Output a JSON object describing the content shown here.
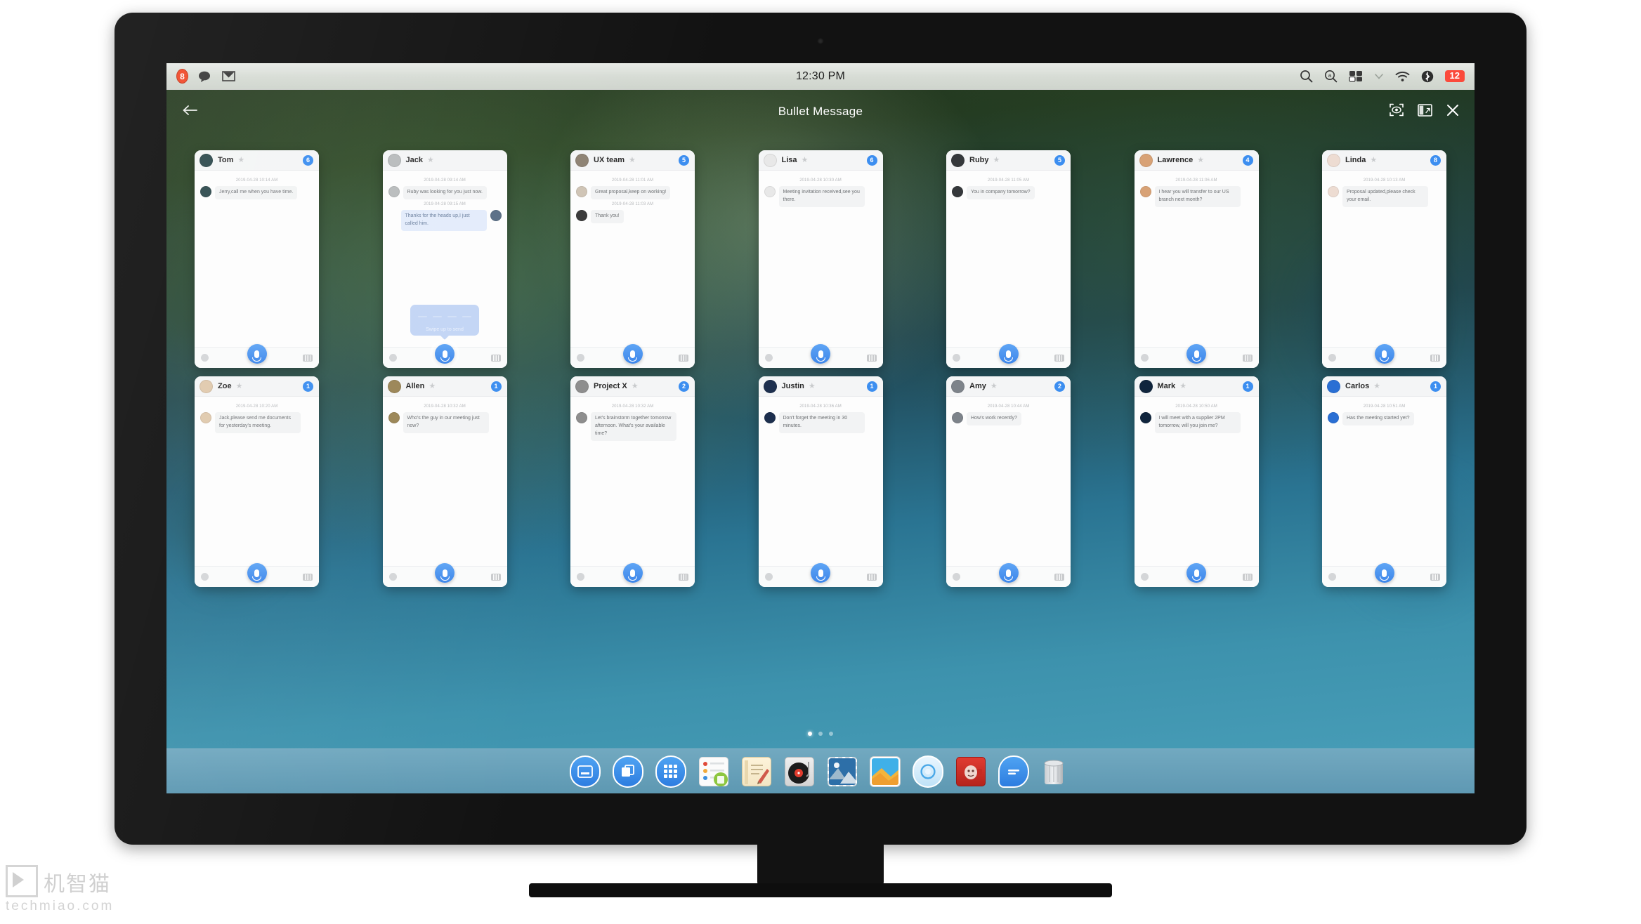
{
  "menubar": {
    "badge_count": "8",
    "clock": "12:30 PM",
    "battery": "12",
    "icons": [
      "notification-badge-icon",
      "messages-icon",
      "mail-icon",
      "search-icon",
      "spotlight-icon",
      "mission-control-icon",
      "chevron-down-icon",
      "wifi-icon",
      "bluetooth-icon"
    ]
  },
  "app": {
    "title": "Bullet Message",
    "back_label": "←",
    "tools": [
      "focus-icon",
      "split-view-icon",
      "close-icon"
    ]
  },
  "page_indicator": {
    "total": 3,
    "active": 1
  },
  "swipe_tip": {
    "label": "Swipe up to send"
  },
  "colors": {
    "accent_blue": "#3c8ef0",
    "badge_red": "#fb4a3b",
    "bubble_gray": "#f2f3f4",
    "bubble_blue": "#e3ecfb",
    "card_bg": "#fdfdfd"
  },
  "cards": [
    {
      "name": "Tom",
      "badge": "6",
      "selected": false,
      "avatar": "#2f4b4e",
      "messages": [
        {
          "ts": "2019-04-28 10:14 AM",
          "text": "Jerry,call me when you have time.",
          "out": false,
          "avatar": "#2f4b4e"
        }
      ]
    },
    {
      "name": "Jack",
      "badge": "",
      "selected": true,
      "avatar": "#b9bcbd",
      "messages": [
        {
          "ts": "2019-04-28 09:14 AM",
          "text": "Ruby was looking for you just now.",
          "out": false,
          "avatar": "#b9bcbd"
        },
        {
          "ts": "2019-04-28 09:15 AM",
          "text": "Thanks for the heads up,I just called him.",
          "out": true,
          "avatar": "#5b6f86"
        }
      ],
      "tip": true
    },
    {
      "name": "UX team",
      "badge": "5",
      "selected": false,
      "avatar": "#8e8273",
      "messages": [
        {
          "ts": "2019-04-28 11:01 AM",
          "text": "Great proposal,keep on working!",
          "out": false,
          "avatar": "#cfc4b5"
        },
        {
          "ts": "2019-04-28 11:03 AM",
          "text": "Thank you!",
          "out": false,
          "avatar": "#3a3a3a"
        }
      ]
    },
    {
      "name": "Lisa",
      "badge": "6",
      "selected": false,
      "avatar": "#e8e8e8",
      "messages": [
        {
          "ts": "2019-04-28 10:30 AM",
          "text": "Meeting invitation received,see you there.",
          "out": false,
          "avatar": "#e8e8e8"
        }
      ]
    },
    {
      "name": "Ruby",
      "badge": "5",
      "selected": false,
      "avatar": "#35383b",
      "messages": [
        {
          "ts": "2019-04-28 11:05 AM",
          "text": "You in company tomorrow?",
          "out": false,
          "avatar": "#35383b"
        }
      ]
    },
    {
      "name": "Lawrence",
      "badge": "4",
      "selected": false,
      "avatar": "#d8a276",
      "messages": [
        {
          "ts": "2019-04-28 11:06 AM",
          "text": "I hear you will transfer to our US branch next month?",
          "out": false,
          "avatar": "#d8a276"
        }
      ]
    },
    {
      "name": "Linda",
      "badge": "8",
      "selected": false,
      "avatar": "#eddcd2",
      "messages": [
        {
          "ts": "2019-04-28 10:13 AM",
          "text": "Proposal updated,please check your email.",
          "out": false,
          "avatar": "#eddcd2"
        }
      ]
    },
    {
      "name": "Zoe",
      "badge": "1",
      "selected": false,
      "avatar": "#e0c9ad",
      "messages": [
        {
          "ts": "2019-04-28 10:20 AM",
          "text": "Jack,please send me documents for yesterday's meeting.",
          "out": false,
          "avatar": "#e0c9ad"
        }
      ]
    },
    {
      "name": "Allen",
      "badge": "1",
      "selected": false,
      "avatar": "#9a8556",
      "messages": [
        {
          "ts": "2019-04-28 10:32 AM",
          "text": "Who's the guy in our meeting just now?",
          "out": false,
          "avatar": "#9a8556"
        }
      ]
    },
    {
      "name": "Project X",
      "badge": "2",
      "selected": false,
      "avatar": "#8d8d8d",
      "messages": [
        {
          "ts": "2019-04-28 10:32 AM",
          "text": "Let's brainstorm together tomorrow afternoon. What's your available time?",
          "out": false,
          "avatar": "#8d8d8d"
        }
      ]
    },
    {
      "name": "Justin",
      "badge": "1",
      "selected": false,
      "avatar": "#1d2f4e",
      "messages": [
        {
          "ts": "2019-04-28 10:36 AM",
          "text": "Don't forget the meeting in 30 minutes.",
          "out": false,
          "avatar": "#1d2f4e"
        }
      ]
    },
    {
      "name": "Amy",
      "badge": "2",
      "selected": false,
      "avatar": "#7d838a",
      "messages": [
        {
          "ts": "2019-04-28 10:44 AM",
          "text": "How's work recently?",
          "out": false,
          "avatar": "#7d838a"
        }
      ]
    },
    {
      "name": "Mark",
      "badge": "1",
      "selected": false,
      "avatar": "#10253d",
      "messages": [
        {
          "ts": "2019-04-28 10:50 AM",
          "text": "I will meet with a supplier 2PM tomorrow, will you join me?",
          "out": false,
          "avatar": "#10253d"
        }
      ]
    },
    {
      "name": "Carlos",
      "badge": "1",
      "selected": false,
      "avatar": "#2a6fd4",
      "messages": [
        {
          "ts": "2019-04-28 10:51 AM",
          "text": "Has the meeting started yet?",
          "out": false,
          "avatar": "#2a6fd4"
        }
      ]
    }
  ],
  "dock": [
    {
      "name": "dock-item-launchpad-window",
      "type": "round"
    },
    {
      "name": "dock-item-finder",
      "type": "round"
    },
    {
      "name": "dock-item-launchpad",
      "type": "round-grid"
    },
    {
      "name": "dock-item-contacts",
      "type": "square"
    },
    {
      "name": "dock-item-notes",
      "type": "square"
    },
    {
      "name": "dock-item-music",
      "type": "square"
    },
    {
      "name": "dock-item-stamp",
      "type": "square"
    },
    {
      "name": "dock-item-photos",
      "type": "square"
    },
    {
      "name": "dock-item-browser",
      "type": "round"
    },
    {
      "name": "dock-item-red-app",
      "type": "square"
    },
    {
      "name": "dock-item-messages",
      "type": "round"
    },
    {
      "name": "dock-item-trash",
      "type": "square"
    }
  ],
  "watermark": {
    "cn": "机智猫",
    "url": "techmiao.com"
  }
}
